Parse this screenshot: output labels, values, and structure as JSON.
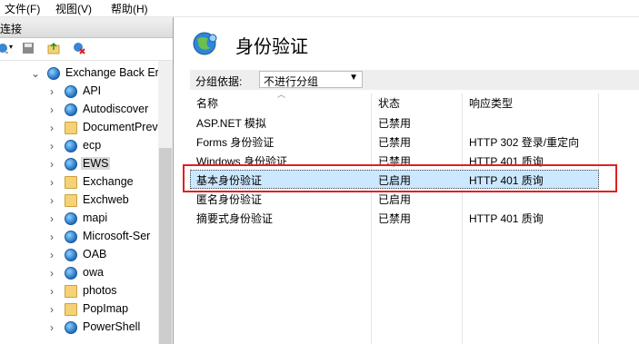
{
  "menu": {
    "file": "文件(F)",
    "view": "视图(V)",
    "help": "帮助(H)"
  },
  "connections": {
    "title": "连接",
    "tree": [
      {
        "label": "Exchange Back Er",
        "icon": "globe-icon",
        "expanded": true
      },
      {
        "label": "API",
        "icon": "globe-icon"
      },
      {
        "label": "Autodiscover",
        "icon": "globe-icon"
      },
      {
        "label": "DocumentPrev",
        "icon": "folder-icon"
      },
      {
        "label": "ecp",
        "icon": "globe-icon"
      },
      {
        "label": "EWS",
        "icon": "globe-icon",
        "selected": true
      },
      {
        "label": "Exchange",
        "icon": "folder-icon"
      },
      {
        "label": "Exchweb",
        "icon": "folder-icon"
      },
      {
        "label": "mapi",
        "icon": "globe-icon"
      },
      {
        "label": "Microsoft-Ser",
        "icon": "globe-icon"
      },
      {
        "label": "OAB",
        "icon": "globe-icon"
      },
      {
        "label": "owa",
        "icon": "globe-icon"
      },
      {
        "label": "photos",
        "icon": "folder-icon"
      },
      {
        "label": "PopImap",
        "icon": "folder-icon"
      },
      {
        "label": "PowerShell",
        "icon": "globe-icon"
      }
    ]
  },
  "page": {
    "title": "身份验证",
    "group_by_label": "分组依据:",
    "group_by_value": "不进行分组",
    "columns": {
      "name": "名称",
      "status": "状态",
      "response": "响应类型"
    },
    "rows": [
      {
        "name": "ASP.NET 模拟",
        "status": "已禁用",
        "response": ""
      },
      {
        "name": "Forms 身份验证",
        "status": "已禁用",
        "response": "HTTP 302 登录/重定向"
      },
      {
        "name": "Windows 身份验证",
        "status": "已禁用",
        "response": "HTTP 401 质询"
      },
      {
        "name": "基本身份验证",
        "status": "已启用",
        "response": "HTTP 401 质询",
        "selected": true
      },
      {
        "name": "匿名身份验证",
        "status": "已启用",
        "response": ""
      },
      {
        "name": "摘要式身份验证",
        "status": "已禁用",
        "response": "HTTP 401 质询"
      }
    ]
  },
  "colors": {
    "selection": "#cce8ff",
    "highlight_box": "#e02020"
  }
}
